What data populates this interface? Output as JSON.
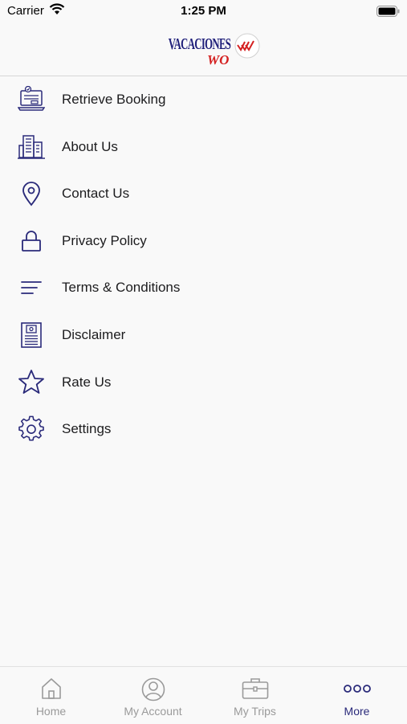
{
  "status_bar": {
    "carrier": "Carrier",
    "time": "1:25 PM"
  },
  "header": {
    "logo_text_top": "VACACIONES",
    "logo_text_bottom": "WO"
  },
  "menu": {
    "items": [
      {
        "label": "Retrieve Booking",
        "icon": "laptop-booking-icon"
      },
      {
        "label": "About Us",
        "icon": "buildings-icon"
      },
      {
        "label": "Contact Us",
        "icon": "location-pin-icon"
      },
      {
        "label": "Privacy Policy",
        "icon": "lock-icon"
      },
      {
        "label": "Terms & Conditions",
        "icon": "lines-icon"
      },
      {
        "label": "Disclaimer",
        "icon": "document-icon"
      },
      {
        "label": "Rate Us",
        "icon": "star-icon"
      },
      {
        "label": "Settings",
        "icon": "gear-icon"
      }
    ]
  },
  "tabs": [
    {
      "label": "Home",
      "icon": "home-icon",
      "active": false
    },
    {
      "label": "My Account",
      "icon": "account-icon",
      "active": false
    },
    {
      "label": "My Trips",
      "icon": "briefcase-icon",
      "active": false
    },
    {
      "label": "More",
      "icon": "more-dots-icon",
      "active": true
    }
  ],
  "colors": {
    "accent": "#2a2a7a",
    "inactive": "#9a9a9a",
    "logo_red": "#d42020"
  }
}
